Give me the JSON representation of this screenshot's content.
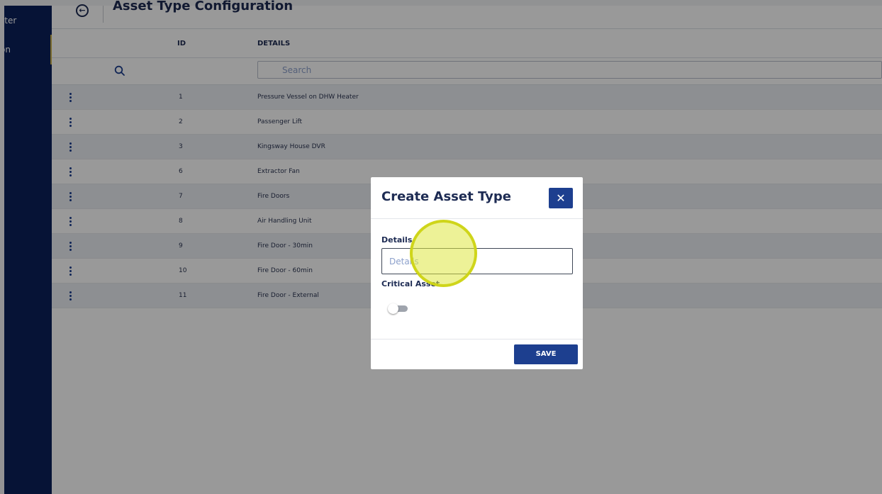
{
  "sidebar": {
    "items": [
      {
        "label": "ster"
      },
      {
        "label": "on"
      }
    ]
  },
  "header": {
    "title": "Asset Type Configuration"
  },
  "table": {
    "columns": [
      "ID",
      "DETAILS"
    ],
    "search_placeholder": "Search",
    "rows": [
      {
        "id": "1",
        "details": "Pressure Vessel on DHW Heater"
      },
      {
        "id": "2",
        "details": "Passenger Lift"
      },
      {
        "id": "3",
        "details": "Kingsway House DVR"
      },
      {
        "id": "6",
        "details": "Extractor Fan"
      },
      {
        "id": "7",
        "details": "Fire Doors"
      },
      {
        "id": "8",
        "details": "Air Handling Unit"
      },
      {
        "id": "9",
        "details": "Fire Door - 30min"
      },
      {
        "id": "10",
        "details": "Fire Door - 60min"
      },
      {
        "id": "11",
        "details": "Fire Door - External"
      }
    ]
  },
  "modal": {
    "title": "Create Asset Type",
    "close_symbol": "✕",
    "details_label": "Details",
    "details_placeholder": "Details",
    "details_value": "",
    "critical_label": "Critical Asset",
    "critical_on": false,
    "save_label": "SAVE"
  },
  "icons": {
    "back": "back-arrow-circle-icon",
    "search": "search-icon",
    "row_menu": "kebab-menu-icon",
    "close": "close-icon"
  },
  "colors": {
    "sidebar": "#0b215a",
    "primary": "#1d3f8f",
    "click_highlight": "#dde842"
  }
}
